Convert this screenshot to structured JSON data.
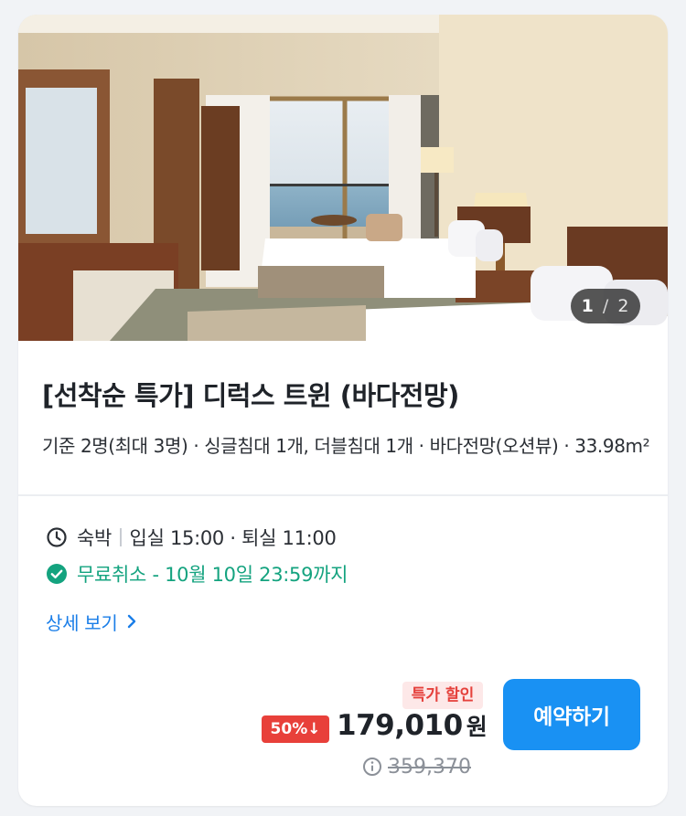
{
  "gallery": {
    "current": "1",
    "separator": "/",
    "total": "2"
  },
  "room": {
    "title": "[선착순 특가] 디럭스 트윈 (바다전망)",
    "description": "기준 2명(최대 3명) · 싱글침대 1개, 더블침대 1개 · 바다전망(오션뷰) · 33.98m²"
  },
  "stay": {
    "type": "숙박",
    "times": "입실 15:00 · 퇴실 11:00"
  },
  "cancellation": {
    "text": "무료취소 - 10월 10일 23:59까지"
  },
  "detail_link": {
    "label": "상세 보기"
  },
  "pricing": {
    "sale_badge": "특가 할인",
    "discount_badge": "50%↓",
    "price": "179,010",
    "currency": "원",
    "original_price": "359,370"
  },
  "book_button": {
    "label": "예약하기"
  },
  "colors": {
    "accent_blue": "#1991f3",
    "link_blue": "#1a7ee8",
    "cancel_green": "#14a37f",
    "sale_red": "#e5413c",
    "discount_red": "#e8403a"
  },
  "icons": {
    "stay": "clock-icon",
    "cancel": "check-circle-icon",
    "detail": "chevron-right-icon",
    "original_price": "info-icon"
  }
}
